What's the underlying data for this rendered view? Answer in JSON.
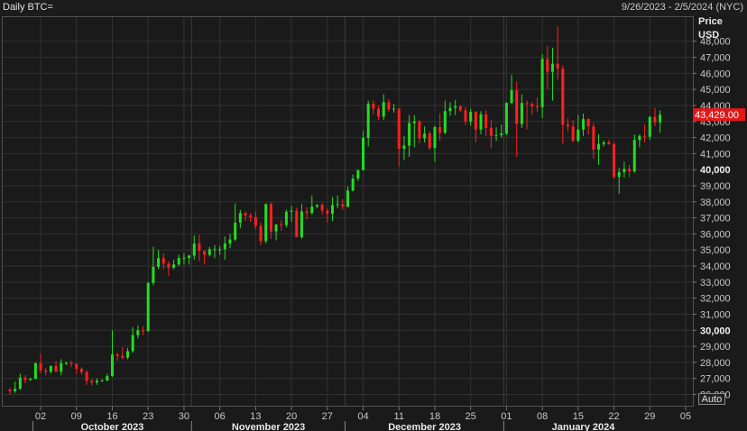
{
  "header": {
    "title": "Daily BTC=",
    "date_range": "9/26/2023 - 2/5/2024 (NYC)"
  },
  "axis": {
    "price_label": "Price",
    "currency_label": "USD",
    "auto_button": "Auto"
  },
  "colors": {
    "background": "#1a1a1a",
    "grid": "#323232",
    "up": "#22dd22",
    "down": "#ff2020",
    "last_price_bg": "#e01818"
  },
  "chart_data": {
    "type": "candlestick",
    "title": "Daily BTC=",
    "ylabel": "Price USD",
    "ylim": [
      25300,
      49500
    ],
    "y_ticks": [
      26000,
      27000,
      28000,
      29000,
      30000,
      31000,
      32000,
      33000,
      34000,
      35000,
      36000,
      37000,
      38000,
      39000,
      40000,
      41000,
      42000,
      43000,
      44000,
      45000,
      46000,
      47000,
      48000
    ],
    "y_tick_labels": [
      "26,000",
      "27,000",
      "28,000",
      "29,000",
      "30,000",
      "31,000",
      "32,000",
      "33,000",
      "34,000",
      "35,000",
      "36,000",
      "37,000",
      "38,000",
      "39,000",
      "40,000",
      "41,000",
      "42,000",
      "43,000",
      "44,000",
      "45,000",
      "46,000",
      "47,000",
      "48,000"
    ],
    "y_bold_ticks": [
      30000,
      40000
    ],
    "x_start": "2023-09-26",
    "x_end": "2024-02-05",
    "x_tick_labels": [
      "02",
      "09",
      "16",
      "23",
      "30",
      "06",
      "13",
      "20",
      "27",
      "04",
      "11",
      "18",
      "25",
      "01",
      "08",
      "15",
      "22",
      "29",
      "05"
    ],
    "x_tick_dates": [
      "2023-10-02",
      "2023-10-09",
      "2023-10-16",
      "2023-10-23",
      "2023-10-30",
      "2023-11-06",
      "2023-11-13",
      "2023-11-20",
      "2023-11-27",
      "2023-12-04",
      "2023-12-11",
      "2023-12-18",
      "2023-12-25",
      "2024-01-01",
      "2024-01-08",
      "2024-01-15",
      "2024-01-22",
      "2024-01-29",
      "2024-02-05"
    ],
    "months": [
      {
        "label": "October 2023",
        "start": "2023-10-01",
        "end": "2023-10-31"
      },
      {
        "label": "November 2023",
        "start": "2023-11-01",
        "end": "2023-11-30"
      },
      {
        "label": "December 2023",
        "start": "2023-12-01",
        "end": "2023-12-31"
      },
      {
        "label": "January 2024",
        "start": "2024-01-01",
        "end": "2024-01-31"
      }
    ],
    "last_price": 43429,
    "last_price_label": "43,429.00",
    "candles": [
      {
        "date": "2023-09-26",
        "o": 26300,
        "h": 26400,
        "l": 26000,
        "c": 26200
      },
      {
        "date": "2023-09-27",
        "o": 26200,
        "h": 26800,
        "l": 26100,
        "c": 26350
      },
      {
        "date": "2023-09-28",
        "o": 26350,
        "h": 27300,
        "l": 26300,
        "c": 27050
      },
      {
        "date": "2023-09-29",
        "o": 27050,
        "h": 27200,
        "l": 26700,
        "c": 26900
      },
      {
        "date": "2023-09-30",
        "o": 26900,
        "h": 27050,
        "l": 26850,
        "c": 26970
      },
      {
        "date": "2023-10-01",
        "o": 26970,
        "h": 28000,
        "l": 26950,
        "c": 27950
      },
      {
        "date": "2023-10-02",
        "o": 27950,
        "h": 28550,
        "l": 27300,
        "c": 27500
      },
      {
        "date": "2023-10-03",
        "o": 27500,
        "h": 27650,
        "l": 27200,
        "c": 27420
      },
      {
        "date": "2023-10-04",
        "o": 27420,
        "h": 27800,
        "l": 27300,
        "c": 27780
      },
      {
        "date": "2023-10-05",
        "o": 27780,
        "h": 28100,
        "l": 27400,
        "c": 27420
      },
      {
        "date": "2023-10-06",
        "o": 27420,
        "h": 28200,
        "l": 27200,
        "c": 27950
      },
      {
        "date": "2023-10-07",
        "o": 27950,
        "h": 28050,
        "l": 27850,
        "c": 27960
      },
      {
        "date": "2023-10-08",
        "o": 27960,
        "h": 28100,
        "l": 27700,
        "c": 27900
      },
      {
        "date": "2023-10-09",
        "o": 27900,
        "h": 27950,
        "l": 27300,
        "c": 27600
      },
      {
        "date": "2023-10-10",
        "o": 27600,
        "h": 27700,
        "l": 27250,
        "c": 27400
      },
      {
        "date": "2023-10-11",
        "o": 27400,
        "h": 27500,
        "l": 26600,
        "c": 26850
      },
      {
        "date": "2023-10-12",
        "o": 26850,
        "h": 26950,
        "l": 26550,
        "c": 26750
      },
      {
        "date": "2023-10-13",
        "o": 26750,
        "h": 27000,
        "l": 26600,
        "c": 26860
      },
      {
        "date": "2023-10-14",
        "o": 26860,
        "h": 26950,
        "l": 26800,
        "c": 26870
      },
      {
        "date": "2023-10-15",
        "o": 26870,
        "h": 27300,
        "l": 26830,
        "c": 27150
      },
      {
        "date": "2023-10-16",
        "o": 27150,
        "h": 30000,
        "l": 27100,
        "c": 28500
      },
      {
        "date": "2023-10-17",
        "o": 28500,
        "h": 28600,
        "l": 28100,
        "c": 28400
      },
      {
        "date": "2023-10-18",
        "o": 28400,
        "h": 28950,
        "l": 28200,
        "c": 28300
      },
      {
        "date": "2023-10-19",
        "o": 28300,
        "h": 28900,
        "l": 28200,
        "c": 28700
      },
      {
        "date": "2023-10-20",
        "o": 28700,
        "h": 30200,
        "l": 28600,
        "c": 29700
      },
      {
        "date": "2023-10-21",
        "o": 29700,
        "h": 30300,
        "l": 29500,
        "c": 30000
      },
      {
        "date": "2023-10-22",
        "o": 30000,
        "h": 30250,
        "l": 29700,
        "c": 29950
      },
      {
        "date": "2023-10-23",
        "o": 29950,
        "h": 33000,
        "l": 29900,
        "c": 32950
      },
      {
        "date": "2023-10-24",
        "o": 32950,
        "h": 35200,
        "l": 32800,
        "c": 33950
      },
      {
        "date": "2023-10-25",
        "o": 33950,
        "h": 35000,
        "l": 33800,
        "c": 34500
      },
      {
        "date": "2023-10-26",
        "o": 34500,
        "h": 34800,
        "l": 33800,
        "c": 34150
      },
      {
        "date": "2023-10-27",
        "o": 34150,
        "h": 34300,
        "l": 33400,
        "c": 33900
      },
      {
        "date": "2023-10-28",
        "o": 33900,
        "h": 34400,
        "l": 33800,
        "c": 34100
      },
      {
        "date": "2023-10-29",
        "o": 34100,
        "h": 34700,
        "l": 34000,
        "c": 34500
      },
      {
        "date": "2023-10-30",
        "o": 34500,
        "h": 34800,
        "l": 34100,
        "c": 34500
      },
      {
        "date": "2023-10-31",
        "o": 34500,
        "h": 34700,
        "l": 34100,
        "c": 34650
      },
      {
        "date": "2023-11-01",
        "o": 34650,
        "h": 35900,
        "l": 34400,
        "c": 35400
      },
      {
        "date": "2023-11-02",
        "o": 35400,
        "h": 35950,
        "l": 34300,
        "c": 34950
      },
      {
        "date": "2023-11-03",
        "o": 34950,
        "h": 34950,
        "l": 34100,
        "c": 34700
      },
      {
        "date": "2023-11-04",
        "o": 34700,
        "h": 35200,
        "l": 34600,
        "c": 35050
      },
      {
        "date": "2023-11-05",
        "o": 35050,
        "h": 35300,
        "l": 34500,
        "c": 35050
      },
      {
        "date": "2023-11-06",
        "o": 35050,
        "h": 35250,
        "l": 34700,
        "c": 35050
      },
      {
        "date": "2023-11-07",
        "o": 35050,
        "h": 35850,
        "l": 34400,
        "c": 35400
      },
      {
        "date": "2023-11-08",
        "o": 35400,
        "h": 36000,
        "l": 35100,
        "c": 35650
      },
      {
        "date": "2023-11-09",
        "o": 35650,
        "h": 37900,
        "l": 35550,
        "c": 36700
      },
      {
        "date": "2023-11-10",
        "o": 36700,
        "h": 37500,
        "l": 36350,
        "c": 37300
      },
      {
        "date": "2023-11-11",
        "o": 37300,
        "h": 37400,
        "l": 36800,
        "c": 37150
      },
      {
        "date": "2023-11-12",
        "o": 37150,
        "h": 37300,
        "l": 36750,
        "c": 37050
      },
      {
        "date": "2023-11-13",
        "o": 37050,
        "h": 37400,
        "l": 36300,
        "c": 36500
      },
      {
        "date": "2023-11-14",
        "o": 36500,
        "h": 36700,
        "l": 35300,
        "c": 35550
      },
      {
        "date": "2023-11-15",
        "o": 35550,
        "h": 37900,
        "l": 35400,
        "c": 37850
      },
      {
        "date": "2023-11-16",
        "o": 37850,
        "h": 37950,
        "l": 35700,
        "c": 36150
      },
      {
        "date": "2023-11-17",
        "o": 36150,
        "h": 36500,
        "l": 35600,
        "c": 36600
      },
      {
        "date": "2023-11-18",
        "o": 36600,
        "h": 36850,
        "l": 36200,
        "c": 36550
      },
      {
        "date": "2023-11-19",
        "o": 36550,
        "h": 37500,
        "l": 36400,
        "c": 37380
      },
      {
        "date": "2023-11-20",
        "o": 37380,
        "h": 37750,
        "l": 36750,
        "c": 37450
      },
      {
        "date": "2023-11-21",
        "o": 37450,
        "h": 37650,
        "l": 35800,
        "c": 35800
      },
      {
        "date": "2023-11-22",
        "o": 35800,
        "h": 37850,
        "l": 35700,
        "c": 37400
      },
      {
        "date": "2023-11-23",
        "o": 37400,
        "h": 37650,
        "l": 36900,
        "c": 37300
      },
      {
        "date": "2023-11-24",
        "o": 37300,
        "h": 38400,
        "l": 37200,
        "c": 37700
      },
      {
        "date": "2023-11-25",
        "o": 37700,
        "h": 37850,
        "l": 37600,
        "c": 37800
      },
      {
        "date": "2023-11-26",
        "o": 37800,
        "h": 37900,
        "l": 37200,
        "c": 37450
      },
      {
        "date": "2023-11-27",
        "o": 37450,
        "h": 37600,
        "l": 36700,
        "c": 37250
      },
      {
        "date": "2023-11-28",
        "o": 37250,
        "h": 38300,
        "l": 36800,
        "c": 37800
      },
      {
        "date": "2023-11-29",
        "o": 37800,
        "h": 38400,
        "l": 37600,
        "c": 37850
      },
      {
        "date": "2023-11-30",
        "o": 37850,
        "h": 38150,
        "l": 37500,
        "c": 37700
      },
      {
        "date": "2023-12-01",
        "o": 37700,
        "h": 38950,
        "l": 37650,
        "c": 38700
      },
      {
        "date": "2023-12-02",
        "o": 38700,
        "h": 39700,
        "l": 38650,
        "c": 39450
      },
      {
        "date": "2023-12-03",
        "o": 39450,
        "h": 40000,
        "l": 39300,
        "c": 39970
      },
      {
        "date": "2023-12-04",
        "o": 39970,
        "h": 42400,
        "l": 39950,
        "c": 41980
      },
      {
        "date": "2023-12-05",
        "o": 41980,
        "h": 44300,
        "l": 41450,
        "c": 44100
      },
      {
        "date": "2023-12-06",
        "o": 44100,
        "h": 44300,
        "l": 43450,
        "c": 43800
      },
      {
        "date": "2023-12-07",
        "o": 43800,
        "h": 44000,
        "l": 43100,
        "c": 43300
      },
      {
        "date": "2023-12-08",
        "o": 43300,
        "h": 44700,
        "l": 43100,
        "c": 44200
      },
      {
        "date": "2023-12-09",
        "o": 44200,
        "h": 44400,
        "l": 43600,
        "c": 43750
      },
      {
        "date": "2023-12-10",
        "o": 43750,
        "h": 44100,
        "l": 43550,
        "c": 43800
      },
      {
        "date": "2023-12-11",
        "o": 43800,
        "h": 43850,
        "l": 40200,
        "c": 41300
      },
      {
        "date": "2023-12-12",
        "o": 41300,
        "h": 42100,
        "l": 40600,
        "c": 41500
      },
      {
        "date": "2023-12-13",
        "o": 41500,
        "h": 43400,
        "l": 40800,
        "c": 42900
      },
      {
        "date": "2023-12-14",
        "o": 42900,
        "h": 43400,
        "l": 41400,
        "c": 43000
      },
      {
        "date": "2023-12-15",
        "o": 43000,
        "h": 43100,
        "l": 41650,
        "c": 41950
      },
      {
        "date": "2023-12-16",
        "o": 41950,
        "h": 42700,
        "l": 41700,
        "c": 42250
      },
      {
        "date": "2023-12-17",
        "o": 42250,
        "h": 42400,
        "l": 41250,
        "c": 41350
      },
      {
        "date": "2023-12-18",
        "o": 41350,
        "h": 42750,
        "l": 40500,
        "c": 42650
      },
      {
        "date": "2023-12-19",
        "o": 42650,
        "h": 43500,
        "l": 41800,
        "c": 42300
      },
      {
        "date": "2023-12-20",
        "o": 42300,
        "h": 44300,
        "l": 42200,
        "c": 43650
      },
      {
        "date": "2023-12-21",
        "o": 43650,
        "h": 44200,
        "l": 43350,
        "c": 43850
      },
      {
        "date": "2023-12-22",
        "o": 43850,
        "h": 44350,
        "l": 43400,
        "c": 43950
      },
      {
        "date": "2023-12-23",
        "o": 43950,
        "h": 44000,
        "l": 43600,
        "c": 43700
      },
      {
        "date": "2023-12-24",
        "o": 43700,
        "h": 43900,
        "l": 42800,
        "c": 43000
      },
      {
        "date": "2023-12-25",
        "o": 43000,
        "h": 43800,
        "l": 42750,
        "c": 43600
      },
      {
        "date": "2023-12-26",
        "o": 43600,
        "h": 43650,
        "l": 41700,
        "c": 42500
      },
      {
        "date": "2023-12-27",
        "o": 42500,
        "h": 43650,
        "l": 42200,
        "c": 43450
      },
      {
        "date": "2023-12-28",
        "o": 43450,
        "h": 43700,
        "l": 42100,
        "c": 42600
      },
      {
        "date": "2023-12-29",
        "o": 42600,
        "h": 43100,
        "l": 41350,
        "c": 42100
      },
      {
        "date": "2023-12-30",
        "o": 42100,
        "h": 42650,
        "l": 41800,
        "c": 42150
      },
      {
        "date": "2023-12-31",
        "o": 42150,
        "h": 42800,
        "l": 42000,
        "c": 42250
      },
      {
        "date": "2024-01-01",
        "o": 42250,
        "h": 44200,
        "l": 42150,
        "c": 44150
      },
      {
        "date": "2024-01-02",
        "o": 44150,
        "h": 45900,
        "l": 44100,
        "c": 44950
      },
      {
        "date": "2024-01-03",
        "o": 44950,
        "h": 45500,
        "l": 40800,
        "c": 42850
      },
      {
        "date": "2024-01-04",
        "o": 42850,
        "h": 44700,
        "l": 42600,
        "c": 44150
      },
      {
        "date": "2024-01-05",
        "o": 44150,
        "h": 44300,
        "l": 42500,
        "c": 44100
      },
      {
        "date": "2024-01-06",
        "o": 44100,
        "h": 44200,
        "l": 43400,
        "c": 43950
      },
      {
        "date": "2024-01-07",
        "o": 43950,
        "h": 44500,
        "l": 43600,
        "c": 43900
      },
      {
        "date": "2024-01-08",
        "o": 43900,
        "h": 47200,
        "l": 43200,
        "c": 46900
      },
      {
        "date": "2024-01-09",
        "o": 46900,
        "h": 47700,
        "l": 45000,
        "c": 46100
      },
      {
        "date": "2024-01-10",
        "o": 46100,
        "h": 47600,
        "l": 44300,
        "c": 46600
      },
      {
        "date": "2024-01-11",
        "o": 46600,
        "h": 48950,
        "l": 45600,
        "c": 46300
      },
      {
        "date": "2024-01-12",
        "o": 46300,
        "h": 46500,
        "l": 41600,
        "c": 42800
      },
      {
        "date": "2024-01-13",
        "o": 42800,
        "h": 43200,
        "l": 42400,
        "c": 42700
      },
      {
        "date": "2024-01-14",
        "o": 42700,
        "h": 43100,
        "l": 41700,
        "c": 41800
      },
      {
        "date": "2024-01-15",
        "o": 41800,
        "h": 43400,
        "l": 41700,
        "c": 42500
      },
      {
        "date": "2024-01-16",
        "o": 42500,
        "h": 43500,
        "l": 42100,
        "c": 43150
      },
      {
        "date": "2024-01-17",
        "o": 43150,
        "h": 43200,
        "l": 42200,
        "c": 42700
      },
      {
        "date": "2024-01-18",
        "o": 42700,
        "h": 42900,
        "l": 40700,
        "c": 41250
      },
      {
        "date": "2024-01-19",
        "o": 41250,
        "h": 42200,
        "l": 40300,
        "c": 41600
      },
      {
        "date": "2024-01-20",
        "o": 41600,
        "h": 41800,
        "l": 41450,
        "c": 41700
      },
      {
        "date": "2024-01-21",
        "o": 41700,
        "h": 41850,
        "l": 41550,
        "c": 41600
      },
      {
        "date": "2024-01-22",
        "o": 41600,
        "h": 41700,
        "l": 39450,
        "c": 39550
      },
      {
        "date": "2024-01-23",
        "o": 39550,
        "h": 40100,
        "l": 38500,
        "c": 39850
      },
      {
        "date": "2024-01-24",
        "o": 39850,
        "h": 40500,
        "l": 39500,
        "c": 40050
      },
      {
        "date": "2024-01-25",
        "o": 40050,
        "h": 40300,
        "l": 39550,
        "c": 39900
      },
      {
        "date": "2024-01-26",
        "o": 39900,
        "h": 42200,
        "l": 39800,
        "c": 41850
      },
      {
        "date": "2024-01-27",
        "o": 41850,
        "h": 42200,
        "l": 41400,
        "c": 42100
      },
      {
        "date": "2024-01-28",
        "o": 42100,
        "h": 42800,
        "l": 41700,
        "c": 42050
      },
      {
        "date": "2024-01-29",
        "o": 42050,
        "h": 43300,
        "l": 41850,
        "c": 43300
      },
      {
        "date": "2024-01-30",
        "o": 43300,
        "h": 43850,
        "l": 42700,
        "c": 42950
      },
      {
        "date": "2024-01-31",
        "o": 42950,
        "h": 43700,
        "l": 42300,
        "c": 43429
      }
    ]
  }
}
